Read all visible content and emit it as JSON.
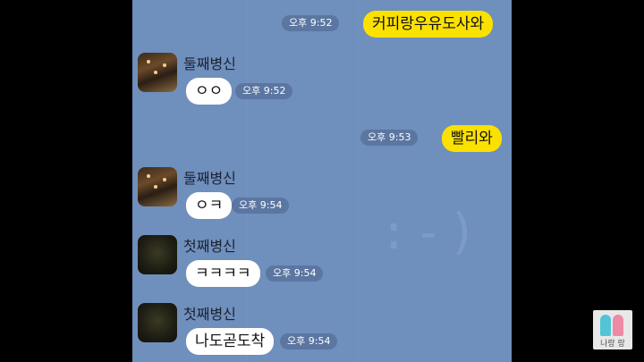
{
  "messages": [
    {
      "kind": "sent",
      "text": "커피랑우유도사와",
      "time": "오후 9:52"
    },
    {
      "kind": "received",
      "sender": "둘째병신",
      "text": "ㅇㅇ",
      "time": "오후 9:52"
    },
    {
      "kind": "sent",
      "text": "빨리와",
      "time": "오후 9:53"
    },
    {
      "kind": "received",
      "sender": "둘째병신",
      "text": "ㅇㅋ",
      "time": "오후 9:54"
    },
    {
      "kind": "received",
      "sender": "첫째병신",
      "text": "ㅋㅋㅋㅋ",
      "time": "오후 9:54"
    },
    {
      "kind": "received",
      "sender": "첫째병신",
      "text": "나도곧도착",
      "time": "오후 9:54"
    }
  ],
  "background_emoticon": ":-)",
  "watermark": {
    "text": "나랑 랑"
  },
  "colors": {
    "chat_bg": "#6f8fbd",
    "sent_bubble": "#fae100",
    "received_bubble": "#ffffff"
  }
}
